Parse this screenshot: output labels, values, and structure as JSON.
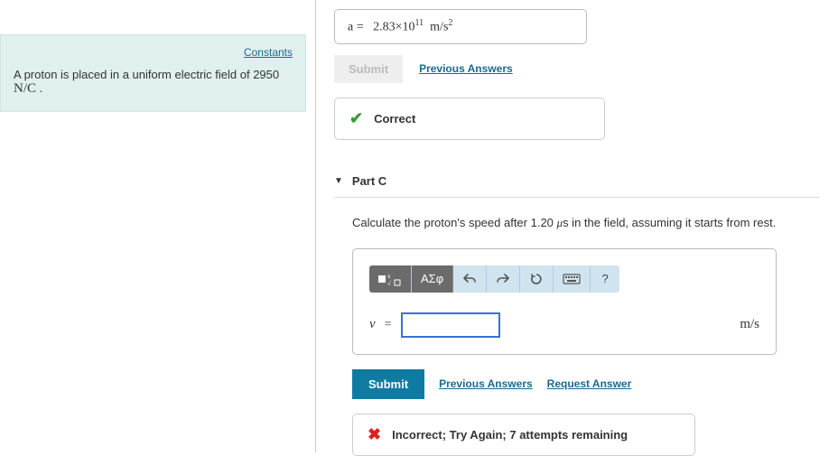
{
  "sidebar": {
    "constants_link": "Constants",
    "problem_text_prefix": "A proton is placed in a uniform electric field of 2950 ",
    "problem_unit": "N/C",
    "problem_text_suffix": " ."
  },
  "prev_answer": {
    "var": "a",
    "eq": "=",
    "value": "2.83×10",
    "exp": "11",
    "spacer": "  ",
    "unit_top": "m/s",
    "unit_exp": "2"
  },
  "prev_submit": {
    "submit_label": "Submit",
    "prev_answers_label": "Previous Answers"
  },
  "correct_feedback": {
    "text": "Correct"
  },
  "partC": {
    "header": "Part C",
    "question_prefix": "Calculate the proton's speed after 1.20 ",
    "question_mu": "μ",
    "question_s": "s",
    "question_suffix": " in the field, assuming it starts from rest.",
    "toolbar": {
      "tmpl_label": "■",
      "greek_label": "ΑΣφ",
      "help_label": "?"
    },
    "input": {
      "var": "v",
      "eq": "=",
      "value": "",
      "unit": "m/s"
    },
    "submit_label": "Submit",
    "prev_answers_label": "Previous Answers",
    "request_answer_label": "Request Answer",
    "incorrect_feedback": "Incorrect; Try Again; 7 attempts remaining"
  }
}
